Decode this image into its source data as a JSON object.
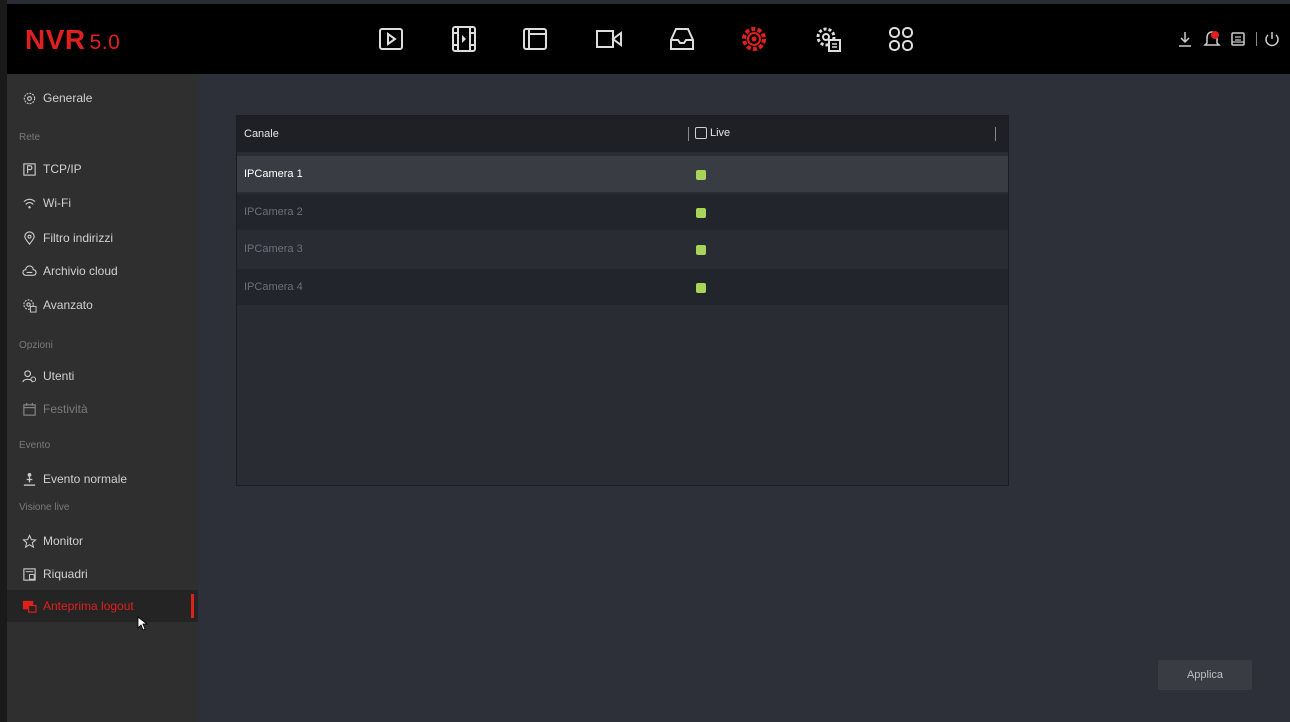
{
  "app": {
    "brand": "NVR",
    "version": "5.0"
  },
  "toolbar": {
    "icons": [
      "playback-icon",
      "video-clip-icon",
      "folder-icon",
      "camera-icon",
      "storage-icon",
      "settings-icon",
      "advanced-settings-icon",
      "apps-grid-icon"
    ],
    "active": "settings-icon"
  },
  "status_icons": [
    "download-icon",
    "alarm-icon",
    "message-icon",
    "power-icon"
  ],
  "sidebar": {
    "general": "Generale",
    "network_head": "Rete",
    "tcpip": "TCP/IP",
    "wifi": "Wi-Fi",
    "ip_filter": "Filtro indirizzi",
    "cloud": "Archivio cloud",
    "advanced": "Avanzato",
    "options_head": "Opzioni",
    "users": "Utenti",
    "holidays": "Festività",
    "event_head": "Evento",
    "normal_event": "Evento normale",
    "live_head": "Visione live",
    "monitor": "Monitor",
    "panes": "Riquadri",
    "logout_preview": "Anteprima logout"
  },
  "table": {
    "col_channel": "Canale",
    "col_live": "Live",
    "rows": [
      {
        "name": "IPCamera 1",
        "live": true
      },
      {
        "name": "IPCamera 2",
        "live": true
      },
      {
        "name": "IPCamera 3",
        "live": true
      },
      {
        "name": "IPCamera 4",
        "live": true
      }
    ]
  },
  "apply_label": "Applica",
  "colors": {
    "accent": "#e0201d",
    "live_on": "#a8d45a"
  }
}
